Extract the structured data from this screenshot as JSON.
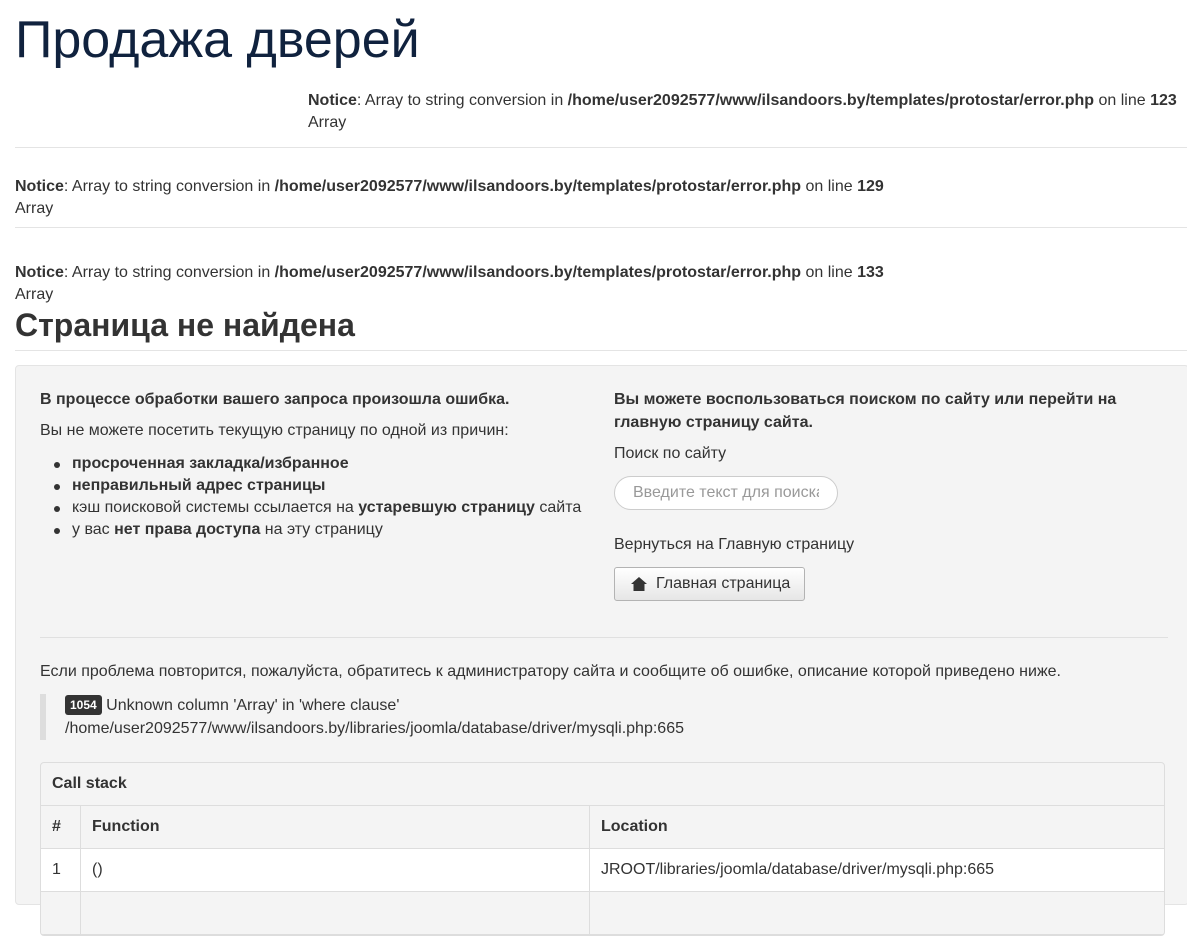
{
  "site": {
    "title": "Продажа дверей"
  },
  "notices": [
    {
      "label": "Notice",
      "message": ": Array to string conversion in ",
      "path": "/home/user2092577/www/ilsandoors.by/templates/protostar/error.php",
      "on_line": " on line ",
      "line": "123",
      "value": "Array"
    },
    {
      "label": "Notice",
      "message": ": Array to string conversion in ",
      "path": "/home/user2092577/www/ilsandoors.by/templates/protostar/error.php",
      "on_line": " on line ",
      "line": "129",
      "value": "Array"
    },
    {
      "label": "Notice",
      "message": ": Array to string conversion in ",
      "path": "/home/user2092577/www/ilsandoors.by/templates/protostar/error.php",
      "on_line": " on line ",
      "line": "133",
      "value": "Array"
    }
  ],
  "page": {
    "heading": "Страница не найдена"
  },
  "left": {
    "title": "В процессе обработки вашего запроса произошла ошибка.",
    "intro": "Вы не можете посетить текущую страницу по одной из причин:",
    "reasons": {
      "r1": "просроченная закладка/избранное",
      "r2": "неправильный адрес страницы",
      "r3_pre": "кэш поисковой системы ссылается на ",
      "r3_bold": "устаревшую страницу",
      "r3_post": " сайта",
      "r4_pre": "у вас ",
      "r4_bold": "нет права доступа",
      "r4_post": " на эту страницу"
    }
  },
  "right": {
    "title": "Вы можете воспользоваться поиском по сайту или перейти на главную страницу сайта.",
    "search_label": "Поиск по сайту",
    "search_placeholder": "Введите текст для поиска...",
    "home_label": "Вернуться на Главную страницу",
    "home_button": "Главная страница"
  },
  "problem_text": "Если проблема повторится, пожалуйста, обратитесь к администратору сайта и сообщите об ошибке, описание которой приведено ниже.",
  "error": {
    "code": "1054",
    "message": " Unknown column 'Array' in 'where clause'",
    "file": "/home/user2092577/www/ilsandoors.by/libraries/joomla/database/driver/mysqli.php:665"
  },
  "callstack": {
    "title": "Call stack",
    "columns": [
      "#",
      "Function",
      "Location"
    ],
    "rows": [
      {
        "num": "1",
        "function": "()",
        "location": "JROOT/libraries/joomla/database/driver/mysqli.php:665"
      }
    ]
  },
  "colors": {
    "title": "#10223e",
    "text": "#333333",
    "well": "#f4f4f4",
    "badge": "#333333"
  }
}
